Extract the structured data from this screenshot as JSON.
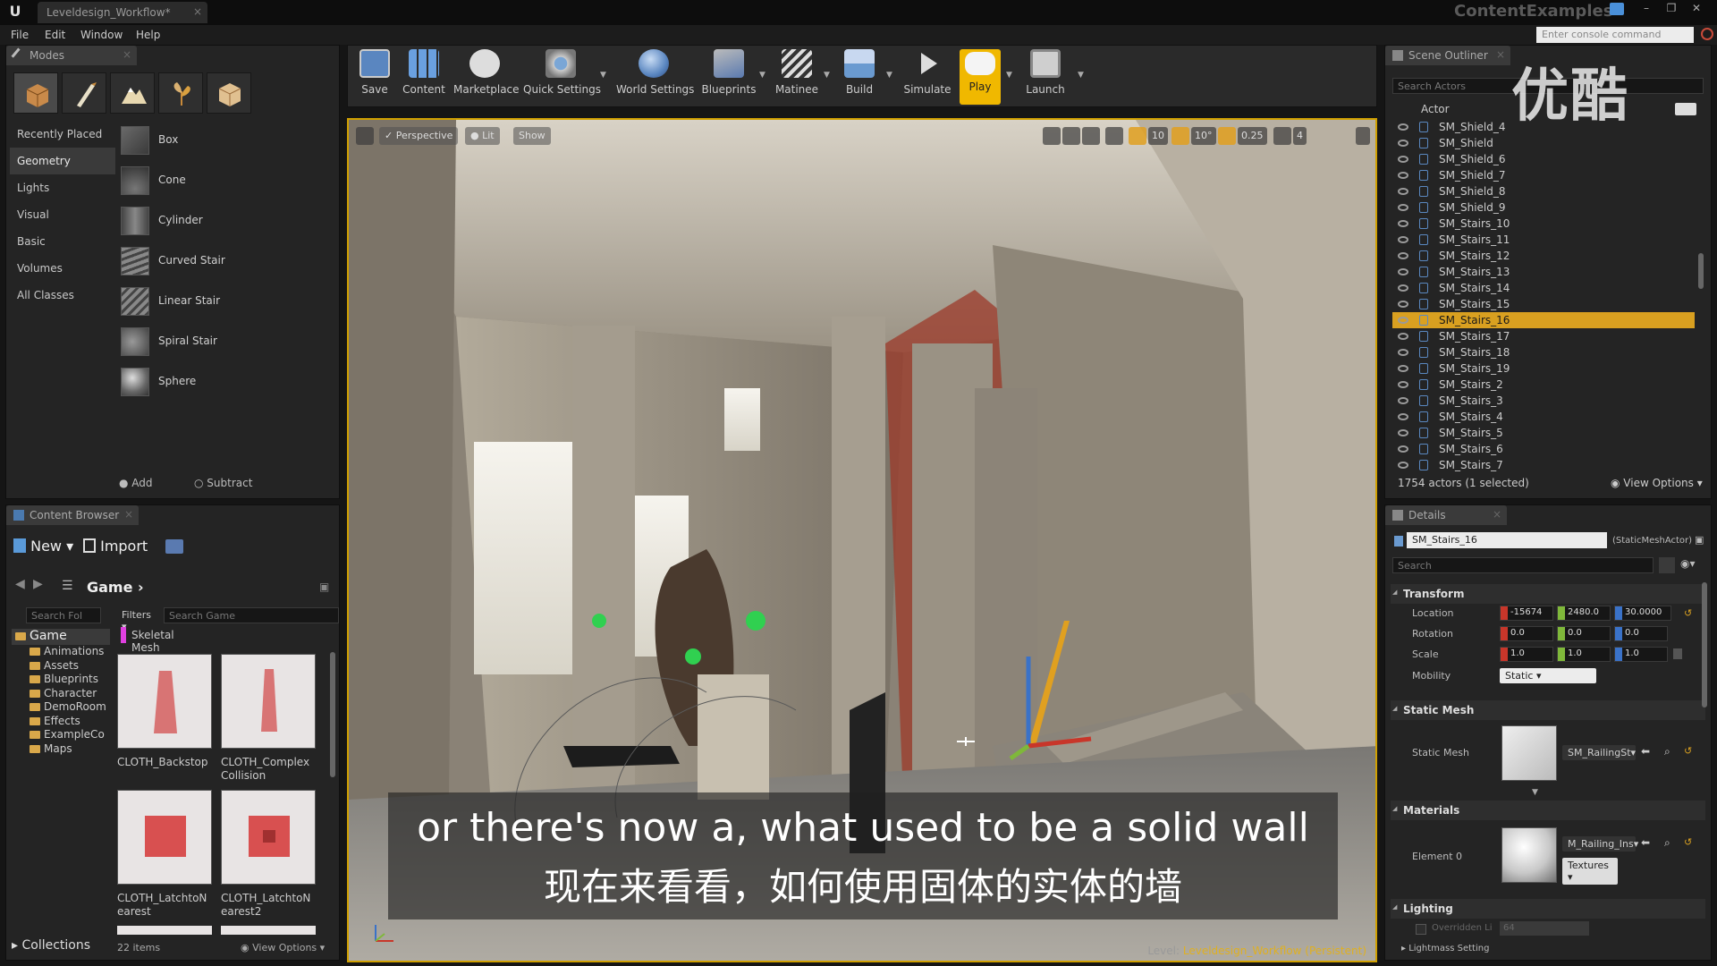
{
  "window": {
    "tab_title": "Leveldesign_Workflow*",
    "project_name": "ContentExamples",
    "console_placeholder": "Enter console command"
  },
  "menu": [
    "File",
    "Edit",
    "Window",
    "Help"
  ],
  "modes": {
    "title": "Modes",
    "categories": [
      "Recently Placed",
      "Geometry",
      "Lights",
      "Visual",
      "Basic",
      "Volumes",
      "All Classes"
    ],
    "active_category": "Geometry",
    "shapes": [
      "Box",
      "Cone",
      "Cylinder",
      "Curved Stair",
      "Linear Stair",
      "Spiral Stair",
      "Sphere"
    ],
    "add_label": "Add",
    "subtract_label": "Subtract"
  },
  "toolbar": {
    "items": [
      "Save",
      "Content",
      "Marketplace",
      "Quick Settings",
      "World Settings",
      "Blueprints",
      "Matinee",
      "Build",
      "Simulate",
      "Play",
      "Launch"
    ],
    "active": "Play"
  },
  "viewport": {
    "perspective_label": "Perspective",
    "lit_label": "Lit",
    "show_label": "Show",
    "grid_snap": "10",
    "rotation_snap": "10°",
    "scale_snap": "0.25",
    "camera_speed": "4",
    "subtitle_en": "or there's now a, what used to be a solid wall",
    "subtitle_zh": "现在来看看，如何使用固体的实体的墙",
    "level_prefix": "Level:",
    "level_name": "Leveldesign_Workflow (Persistent)"
  },
  "content_browser": {
    "title": "Content Browser",
    "new_label": "New",
    "import_label": "Import",
    "path": "Game",
    "search_folders_placeholder": "Search Fol",
    "filters_label": "Filters",
    "search_placeholder": "Search Game",
    "filter_tag": "Skeletal Mesh",
    "tree_root": "Game",
    "tree": [
      "Animations",
      "Assets",
      "Blueprints",
      "Character",
      "DemoRoom",
      "Effects",
      "ExampleCo",
      "Maps"
    ],
    "assets": [
      "CLOTH_Backstop",
      "CLOTH_Complex\nCollision",
      "CLOTH_LatchtoN\nearest",
      "CLOTH_LatchtoN\nearest2"
    ],
    "collections_label": "Collections",
    "item_count": "22 items",
    "view_options": "View Options"
  },
  "outliner": {
    "title": "Scene Outliner",
    "search_placeholder": "Search Actors",
    "column_actor": "Actor",
    "rows": [
      "SM_Shield_4",
      "SM_Shield",
      "SM_Shield_6",
      "SM_Shield_7",
      "SM_Shield_8",
      "SM_Shield_9",
      "SM_Stairs_10",
      "SM_Stairs_11",
      "SM_Stairs_12",
      "SM_Stairs_13",
      "SM_Stairs_14",
      "SM_Stairs_15",
      "SM_Stairs_16",
      "SM_Stairs_17",
      "SM_Stairs_18",
      "SM_Stairs_19",
      "SM_Stairs_2",
      "SM_Stairs_3",
      "SM_Stairs_4",
      "SM_Stairs_5",
      "SM_Stairs_6",
      "SM_Stairs_7"
    ],
    "selected": "SM_Stairs_16",
    "status": "1754 actors (1 selected)",
    "view_options": "View Options"
  },
  "details": {
    "title": "Details",
    "actor_name": "SM_Stairs_16",
    "actor_class": "(StaticMeshActor)",
    "search_placeholder": "Search",
    "transform_header": "Transform",
    "location_label": "Location",
    "location": [
      "-15674",
      "2480.0",
      "30.0000"
    ],
    "rotation_label": "Rotation",
    "rotation": [
      "0.0",
      "0.0",
      "0.0"
    ],
    "scale_label": "Scale",
    "scale": [
      "1.0",
      "1.0",
      "1.0"
    ],
    "mobility_label": "Mobility",
    "mobility": "Static",
    "static_mesh_header": "Static Mesh",
    "static_mesh_label": "Static Mesh",
    "static_mesh_value": "SM_RailingSt",
    "materials_header": "Materials",
    "element_label": "Element 0",
    "material_value": "M_Railing_Ins",
    "textures_label": "Textures",
    "lighting_header": "Lighting",
    "overridden_label": "Overridden Li",
    "overridden_value": "64",
    "lightmass_label": "Lightmass Setting"
  },
  "watermark": "优酷",
  "colors": {
    "accent": "#d9a020",
    "play_active": "#f0b800",
    "axis_x": "#c8362a",
    "axis_y": "#7fb83a",
    "axis_z": "#3a72c8"
  }
}
